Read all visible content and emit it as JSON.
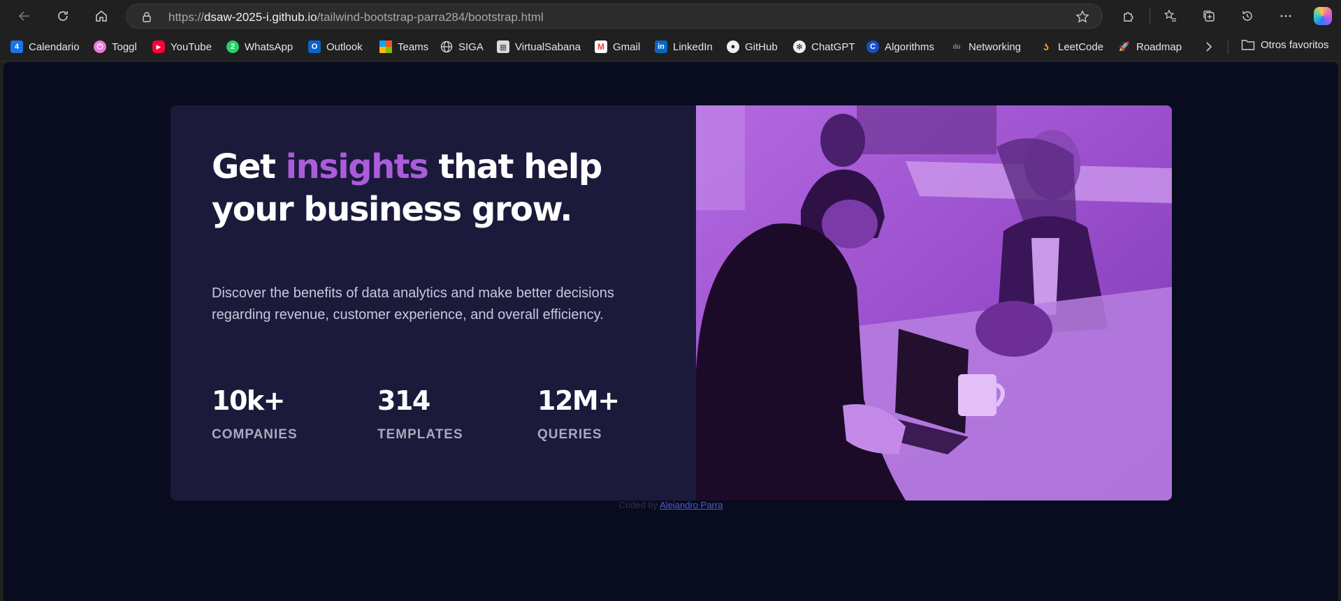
{
  "browser": {
    "url_scheme": "https://",
    "url_host": "dsaw-2025-i.github.io",
    "url_path": "/tailwind-bootstrap-parra284/bootstrap.html",
    "bookmarks": [
      {
        "label": "Calendario",
        "icon": "calendar-icon"
      },
      {
        "label": "Toggl",
        "icon": "toggl-icon"
      },
      {
        "label": "YouTube",
        "icon": "youtube-icon"
      },
      {
        "label": "WhatsApp",
        "icon": "whatsapp-icon"
      },
      {
        "label": "Outlook",
        "icon": "outlook-icon"
      },
      {
        "label": "Teams",
        "icon": "teams-icon"
      },
      {
        "label": "SIGA",
        "icon": "globe-icon"
      },
      {
        "label": "VirtualSabana",
        "icon": "virtualsabana-icon"
      },
      {
        "label": "Gmail",
        "icon": "gmail-icon"
      },
      {
        "label": "LinkedIn",
        "icon": "linkedin-icon"
      },
      {
        "label": "GitHub",
        "icon": "github-icon"
      },
      {
        "label": "ChatGPT",
        "icon": "chatgpt-icon"
      },
      {
        "label": "Algorithms",
        "icon": "algorithms-icon"
      },
      {
        "label": "Networking",
        "icon": "cisco-icon"
      },
      {
        "label": "LeetCode",
        "icon": "leetcode-icon"
      },
      {
        "label": "Roadmap",
        "icon": "rocket-icon"
      }
    ],
    "other_favorites": "Otros favoritos"
  },
  "page": {
    "headline_pre": "Get ",
    "headline_accent": "insights",
    "headline_post": " that help your business grow.",
    "description": "Discover the benefits of data analytics and make better decisions regarding revenue, customer experience, and overall efficiency.",
    "stats": [
      {
        "value": "10k+",
        "label": "COMPANIES"
      },
      {
        "value": "314",
        "label": "TEMPLATES"
      },
      {
        "value": "12M+",
        "label": "QUERIES"
      }
    ],
    "credit_prefix": "Coded by ",
    "credit_author": "Alejandro Parra"
  },
  "colors": {
    "page_bg": "#080c1e",
    "card_bg": "#1b1a3b",
    "accent": "#ab5cdb",
    "image_overlay": "#9d51cf"
  }
}
